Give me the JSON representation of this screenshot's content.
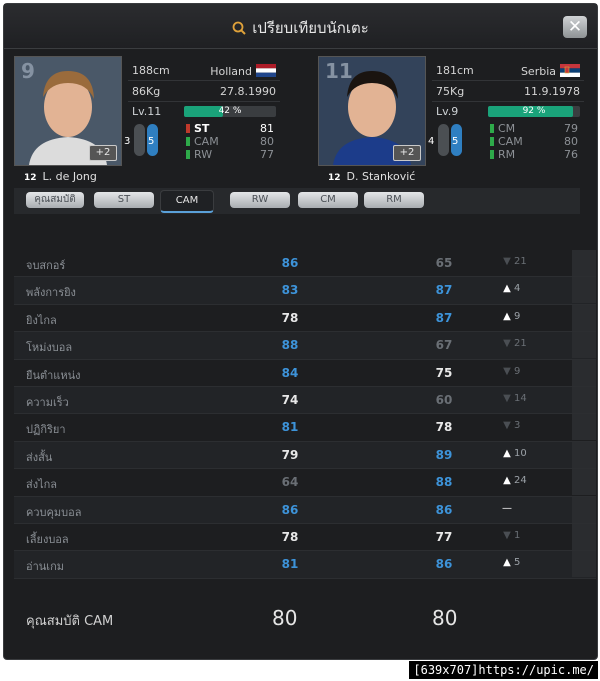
{
  "window": {
    "title": "เปรียบเทียบนักเตะ",
    "close_label": "✕"
  },
  "players": [
    {
      "number": "9",
      "name": "L. de Jong",
      "tag": "12",
      "rank": "+2",
      "height": "188cm",
      "weight": "86Kg",
      "country": "Holland",
      "dob": "27.8.1990",
      "level": "Lv.11",
      "progress_pct": 42,
      "progress_label": "42 %",
      "left_foot": "3",
      "right_foot": "5",
      "positions": [
        {
          "name": "ST",
          "value": "81",
          "color": "#c0392b",
          "highlight": true
        },
        {
          "name": "CAM",
          "value": "80",
          "color": "#2eaa4a",
          "highlight": false
        },
        {
          "name": "RW",
          "value": "77",
          "color": "#2eaa4a",
          "highlight": false
        }
      ]
    },
    {
      "number": "11",
      "name": "D. Stanković",
      "tag": "12",
      "rank": "+2",
      "height": "181cm",
      "weight": "75Kg",
      "country": "Serbia",
      "dob": "11.9.1978",
      "level": "Lv.9",
      "progress_pct": 92,
      "progress_label": "92 %",
      "left_foot": "4",
      "right_foot": "5",
      "positions": [
        {
          "name": "CM",
          "value": "79",
          "color": "#2eaa4a",
          "highlight": false
        },
        {
          "name": "CAM",
          "value": "80",
          "color": "#2eaa4a",
          "highlight": false
        },
        {
          "name": "RM",
          "value": "76",
          "color": "#2eaa4a",
          "highlight": false
        }
      ]
    }
  ],
  "tabs": [
    "คุณสมบัติ",
    "ST",
    "CAM",
    "RW",
    "CM",
    "RM"
  ],
  "active_tab": "CAM",
  "stats": [
    {
      "label": "จบสกอร์",
      "v1": "86",
      "v2": "65",
      "c1": "blue",
      "c2": "gray",
      "dir": "down",
      "diff": "21"
    },
    {
      "label": "พลังการยิง",
      "v1": "83",
      "v2": "87",
      "c1": "blue",
      "c2": "blue",
      "dir": "up",
      "diff": "4"
    },
    {
      "label": "ยิงไกล",
      "v1": "78",
      "v2": "87",
      "c1": "white",
      "c2": "blue",
      "dir": "up",
      "diff": "9"
    },
    {
      "label": "โหม่งบอล",
      "v1": "88",
      "v2": "67",
      "c1": "blue",
      "c2": "gray",
      "dir": "down",
      "diff": "21"
    },
    {
      "label": "ยืนตำแหน่ง",
      "v1": "84",
      "v2": "75",
      "c1": "blue",
      "c2": "white",
      "dir": "down",
      "diff": "9"
    },
    {
      "label": "ความเร็ว",
      "v1": "74",
      "v2": "60",
      "c1": "white",
      "c2": "gray",
      "dir": "down",
      "diff": "14"
    },
    {
      "label": "ปฏิกิริยา",
      "v1": "81",
      "v2": "78",
      "c1": "blue",
      "c2": "white",
      "dir": "down",
      "diff": "3"
    },
    {
      "label": "ส่งสั้น",
      "v1": "79",
      "v2": "89",
      "c1": "white",
      "c2": "blue",
      "dir": "up",
      "diff": "10"
    },
    {
      "label": "ส่งไกล",
      "v1": "64",
      "v2": "88",
      "c1": "gray",
      "c2": "blue",
      "dir": "up",
      "diff": "24"
    },
    {
      "label": "ควบคุมบอล",
      "v1": "86",
      "v2": "86",
      "c1": "blue",
      "c2": "blue",
      "dir": "equal",
      "diff": ""
    },
    {
      "label": "เลี้ยงบอล",
      "v1": "78",
      "v2": "77",
      "c1": "white",
      "c2": "white",
      "dir": "down",
      "diff": "1"
    },
    {
      "label": "อ่านเกม",
      "v1": "81",
      "v2": "86",
      "c1": "blue",
      "c2": "blue",
      "dir": "up",
      "diff": "5"
    }
  ],
  "total": {
    "label": "คุณสมบัติ CAM",
    "v1": "80",
    "v2": "80"
  },
  "credit": "[639x707]https://upic.me/"
}
